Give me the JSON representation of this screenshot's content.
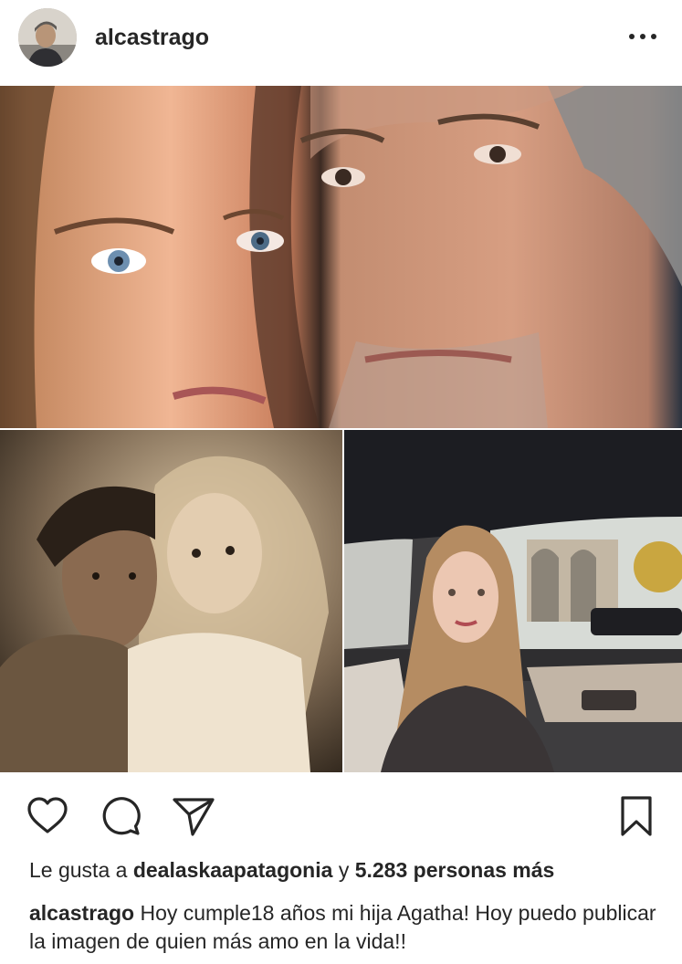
{
  "post": {
    "username": "alcastrago",
    "avatar_icon": "profile-photo",
    "more_icon": "more-horizontal-icon"
  },
  "media": {
    "photos": [
      {
        "name": "closeup-selfie"
      },
      {
        "name": "vintage-sepia-photo"
      },
      {
        "name": "car-selfie"
      }
    ]
  },
  "actions": {
    "like_icon": "heart-icon",
    "comment_icon": "comment-icon",
    "share_icon": "send-icon",
    "save_icon": "bookmark-icon"
  },
  "likes": {
    "prefix": "Le gusta a",
    "user": "dealaskaapatagonia",
    "connector": "y",
    "others": "5.283 personas más"
  },
  "caption": {
    "username": "alcastrago",
    "text": "Hoy cumple18 años mi hija Agatha! Hoy puedo publicar la imagen de quien más amo en la vida!!"
  }
}
